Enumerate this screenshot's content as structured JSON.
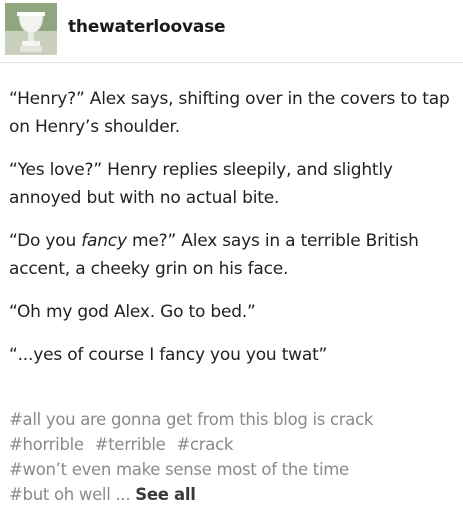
{
  "header": {
    "username": "thewaterloovase",
    "avatar_icon": "vase-avatar-icon"
  },
  "post": {
    "paragraphs": [
      {
        "text": "“Henry?” Alex says, shifting over in the covers to tap on Henry’s shoulder."
      },
      {
        "text": "“Yes love?” Henry replies sleepily, and slightly annoyed but with no actual bite."
      },
      {
        "before": "“Do you ",
        "emphasis": "fancy",
        "after": " me?” Alex says in a terrible British accent, a cheeky grin on his face."
      },
      {
        "text": "“Oh my god Alex. Go to bed.”"
      },
      {
        "text": "“...yes of course I fancy you you twat”"
      }
    ]
  },
  "tags": {
    "items": [
      "#all you are gonna get from this blog is crack",
      "#horrible",
      "#terrible",
      "#crack",
      "#won’t even make sense most of the time",
      "#but oh well"
    ],
    "ellipsis": "...",
    "see_all_label": "See all"
  }
}
